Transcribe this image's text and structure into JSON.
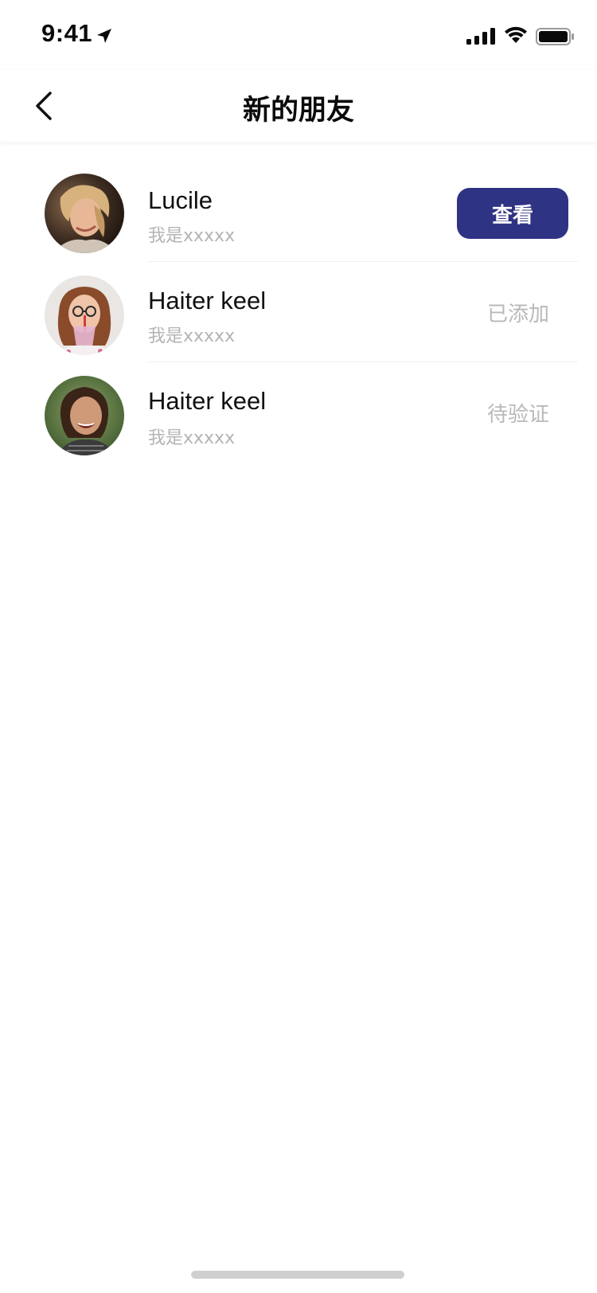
{
  "status_bar": {
    "time": "9:41",
    "icons": [
      "location-arrow-icon",
      "signal-icon",
      "wifi-icon",
      "battery-icon"
    ]
  },
  "nav": {
    "title": "新的朋友",
    "back_icon": "chevron-left-icon"
  },
  "friends": [
    {
      "name": "Lucile",
      "message": "我是xxxxx",
      "action": "查看",
      "action_type": "button"
    },
    {
      "name": "Haiter keel",
      "message": "我是xxxxx",
      "action": "已添加",
      "action_type": "status"
    },
    {
      "name": "Haiter keel",
      "message": "我是xxxxx",
      "action": "待验证",
      "action_type": "status"
    }
  ],
  "colors": {
    "accent": "#2f3383",
    "muted_text": "#b4b4b4",
    "divider": "#f0f0f0"
  }
}
